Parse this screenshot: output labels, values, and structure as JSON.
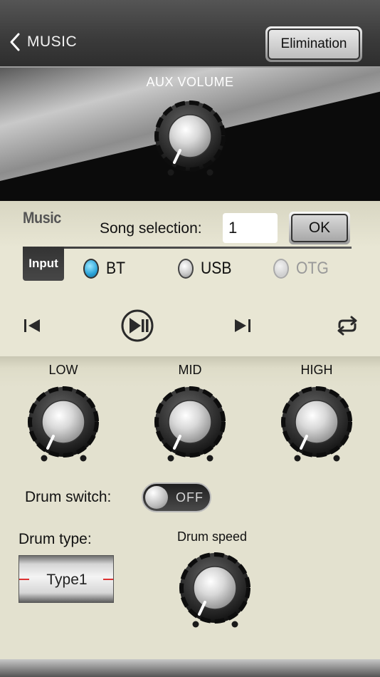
{
  "header": {
    "back_label": "MUSIC",
    "elimination_label": "Elimination"
  },
  "aux": {
    "label": "AUX VOLUME"
  },
  "music": {
    "title": "Music",
    "song_selection_label": "Song selection:",
    "song_selection_value": "1",
    "ok_label": "OK",
    "input_label": "Input",
    "inputs": [
      {
        "label": "BT",
        "state": "selected"
      },
      {
        "label": "USB",
        "state": "unselected"
      },
      {
        "label": "OTG",
        "state": "disabled"
      }
    ]
  },
  "playback": {
    "prev_icon": "skip-previous-icon",
    "play_pause_icon": "play-pause-icon",
    "next_icon": "skip-next-icon",
    "repeat_icon": "repeat-icon"
  },
  "eq": {
    "low_label": "LOW",
    "mid_label": "MID",
    "high_label": "HIGH"
  },
  "drum": {
    "switch_label": "Drum switch:",
    "switch_state": "OFF",
    "type_label": "Drum type:",
    "type_value": "Type1",
    "speed_label": "Drum speed"
  },
  "colors": {
    "accent_blue": "#2aa3d8",
    "panel_bg": "#e3e1cf",
    "header_bg": "#3c3c3c"
  }
}
